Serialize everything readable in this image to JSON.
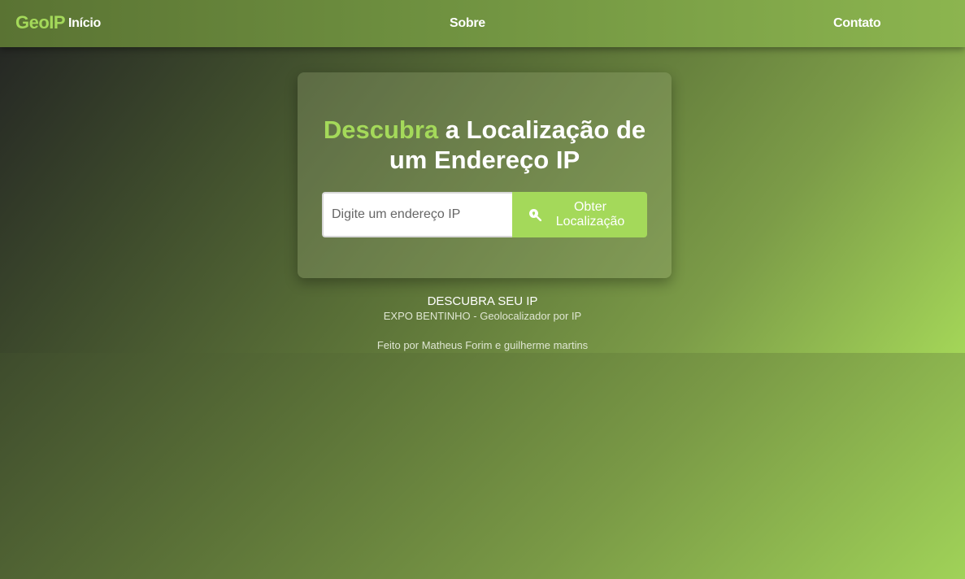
{
  "nav": {
    "logo": "GeoIP",
    "links": [
      {
        "label": "Início"
      },
      {
        "label": "Sobre"
      },
      {
        "label": "Contato"
      }
    ]
  },
  "hero": {
    "title_highlight": "Descubra",
    "title_rest_line1": " a Localização de",
    "title_line2": "um Endereço IP",
    "input": {
      "placeholder": "Digite um endereço IP",
      "value": ""
    },
    "button": {
      "icon": "search-location-icon",
      "label": "Obter Localização"
    }
  },
  "footer": {
    "title": "DESCUBRA SEU IP",
    "subtitle": "EXPO BENTINHO - Geolocalizador por IP",
    "credit": "Feito por Matheus Forim e guilherme martins"
  },
  "colors": {
    "accent": "#a4d95a",
    "text": "#ffffff"
  }
}
